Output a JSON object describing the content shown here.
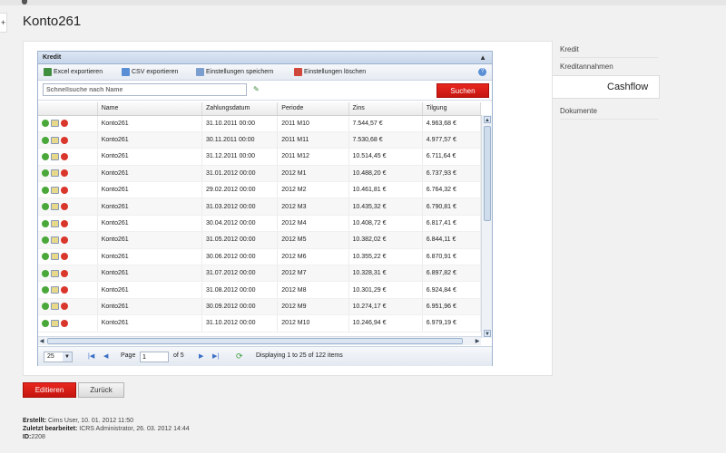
{
  "page": {
    "title": "Konto261",
    "left_tab_glyph": "+"
  },
  "grid": {
    "title": "Kredit",
    "toolbar": [
      {
        "label": "Excel exportieren",
        "icon": "excel-icon",
        "color": "#3f8f3f"
      },
      {
        "label": "CSV exportieren",
        "icon": "csv-icon",
        "color": "#5a8fd6"
      },
      {
        "label": "Einstellungen speichern",
        "icon": "save-settings-icon",
        "color": "#7a9ecf"
      },
      {
        "label": "Einstellungen löschen",
        "icon": "delete-settings-icon",
        "color": "#d0483c"
      }
    ],
    "search": {
      "placeholder": "Schnellsuche nach Name",
      "button": "Suchen"
    },
    "columns": [
      "",
      "Name",
      "Zahlungsdatum",
      "Periode",
      "Zins",
      "Tilgung"
    ],
    "rows": [
      [
        "Konto261",
        "31.10.2011 00:00",
        "2011 M10",
        "7.544,57 €",
        "4.963,68 €"
      ],
      [
        "Konto261",
        "30.11.2011 00:00",
        "2011 M11",
        "7.530,68 €",
        "4.977,57 €"
      ],
      [
        "Konto261",
        "31.12.2011 00:00",
        "2011 M12",
        "10.514,45 €",
        "6.711,64 €"
      ],
      [
        "Konto261",
        "31.01.2012 00:00",
        "2012 M1",
        "10.488,20 €",
        "6.737,93 €"
      ],
      [
        "Konto261",
        "29.02.2012 00:00",
        "2012 M2",
        "10.461,81 €",
        "6.764,32 €"
      ],
      [
        "Konto261",
        "31.03.2012 00:00",
        "2012 M3",
        "10.435,32 €",
        "6.790,81 €"
      ],
      [
        "Konto261",
        "30.04.2012 00:00",
        "2012 M4",
        "10.408,72 €",
        "6.817,41 €"
      ],
      [
        "Konto261",
        "31.05.2012 00:00",
        "2012 M5",
        "10.382,02 €",
        "6.844,11 €"
      ],
      [
        "Konto261",
        "30.06.2012 00:00",
        "2012 M6",
        "10.355,22 €",
        "6.870,91 €"
      ],
      [
        "Konto261",
        "31.07.2012 00:00",
        "2012 M7",
        "10.328,31 €",
        "6.897,82 €"
      ],
      [
        "Konto261",
        "31.08.2012 00:00",
        "2012 M8",
        "10.301,29 €",
        "6.924,84 €"
      ],
      [
        "Konto261",
        "30.09.2012 00:00",
        "2012 M9",
        "10.274,17 €",
        "6.951,96 €"
      ],
      [
        "Konto261",
        "31.10.2012 00:00",
        "2012 M10",
        "10.246,94 €",
        "6.979,19 €"
      ]
    ],
    "pager": {
      "page_size": "25",
      "page_label": "Page",
      "page_value": "1",
      "of_label": "of 5",
      "display": "Displaying 1 to 25 of 122 items"
    }
  },
  "nav": {
    "items": [
      "Kredit",
      "Kreditannahmen"
    ],
    "active": "Cashflow",
    "after": [
      "Dokumente"
    ]
  },
  "actions": {
    "edit": "Editieren",
    "back": "Zurück"
  },
  "meta": {
    "created_label": "Erstellt:",
    "created_value": "Cims User, 10. 01. 2012 11:50",
    "edited_label": "Zuletzt bearbeitet:",
    "edited_value": "ICRS Administrator, 26. 03. 2012 14:44",
    "id_label": "ID:",
    "id_value": "2208"
  },
  "colors": {
    "accent_red": "#d71e16",
    "grid_blue": "#9db3d0"
  }
}
